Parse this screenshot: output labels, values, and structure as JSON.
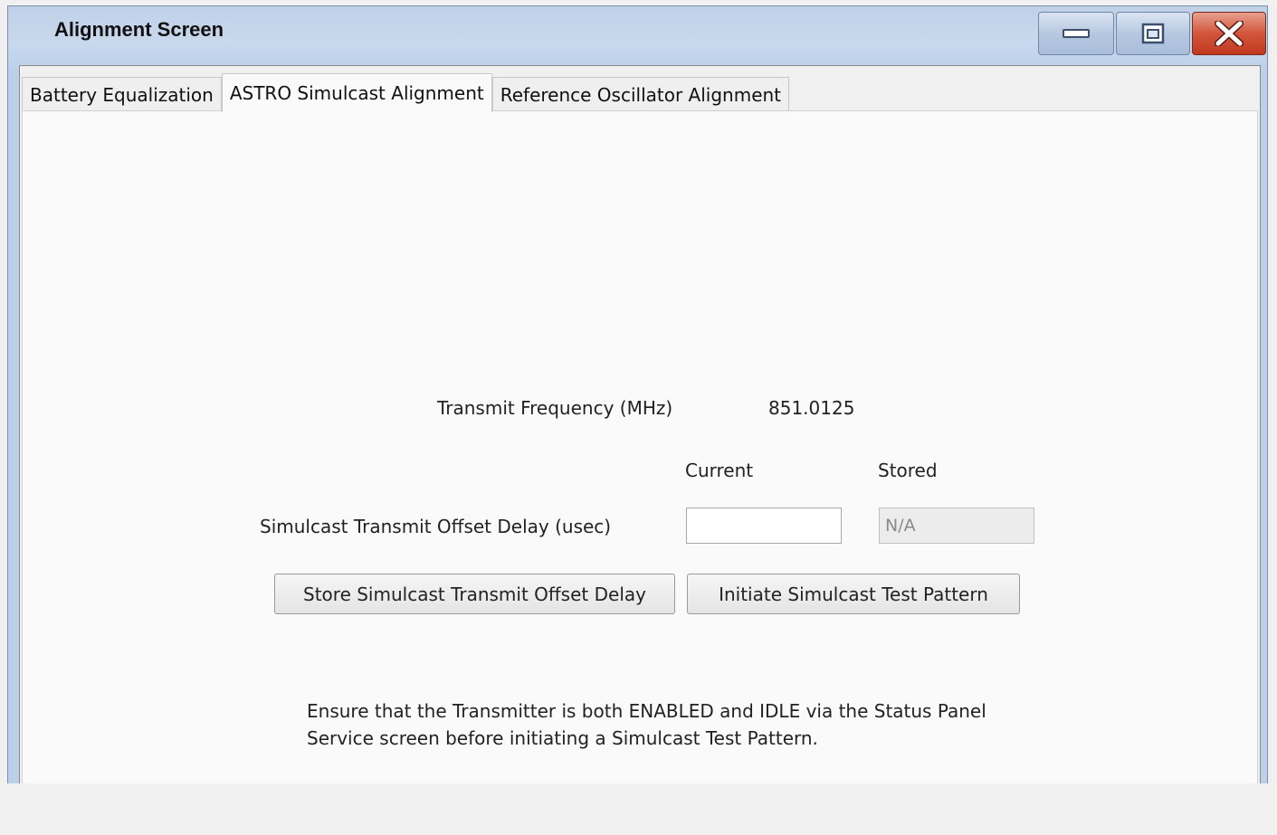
{
  "window": {
    "title": "Alignment Screen"
  },
  "title_buttons": {
    "minimize_icon": "minimize-icon",
    "maximize_icon": "maximize-icon",
    "close_icon": "close-icon"
  },
  "tabs": [
    {
      "label": "Battery Equalization",
      "active": false
    },
    {
      "label": "ASTRO Simulcast Alignment",
      "active": true
    },
    {
      "label": "Reference Oscillator Alignment",
      "active": false
    }
  ],
  "form": {
    "transmit_frequency_label": "Transmit Frequency (MHz)",
    "transmit_frequency_value": "851.0125",
    "current_header": "Current",
    "stored_header": "Stored",
    "offset_delay_label": "Simulcast Transmit Offset Delay (usec)",
    "current_value": "",
    "stored_value": "N/A"
  },
  "buttons": {
    "store": "Store Simulcast Transmit Offset Delay",
    "initiate": "Initiate Simulcast Test Pattern"
  },
  "note": {
    "line1": "Ensure that the Transmitter is both ENABLED and IDLE via the Status Panel",
    "line2": "Service screen before initiating a Simulcast Test Pattern."
  },
  "colors": {
    "close_button": "#c0391f",
    "titlebar": "#c9d8ec"
  }
}
